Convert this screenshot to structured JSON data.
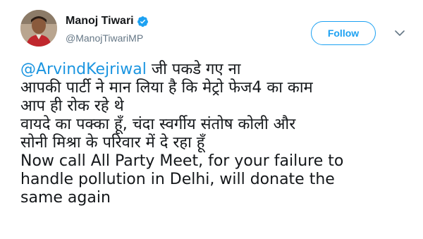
{
  "author": {
    "name": "Manoj Tiwari",
    "handle": "@ManojTiwariMP",
    "verified": true
  },
  "actions": {
    "follow_label": "Follow"
  },
  "tweet": {
    "mention": "@ArvindKejriwal",
    "line1_rest": " जी पकडे गए ना",
    "lines": [
      "आपकी पार्टी ने मान लिया है कि मेट्रो फेज4 का काम",
      "आप ही रोक रहे थे",
      "वायदे का पक्का हूँ, चंदा स्वर्गीय संतोष कोली और",
      "सोनी मिश्रा के परिवार में दे रहा हूँ",
      "Now call All Party Meet, for your failure to",
      "handle pollution in Delhi, will donate the",
      "same again"
    ]
  },
  "colors": {
    "accent": "#1da1f2",
    "mention": "#1b95e0",
    "text": "#14171a",
    "secondary": "#657786"
  }
}
